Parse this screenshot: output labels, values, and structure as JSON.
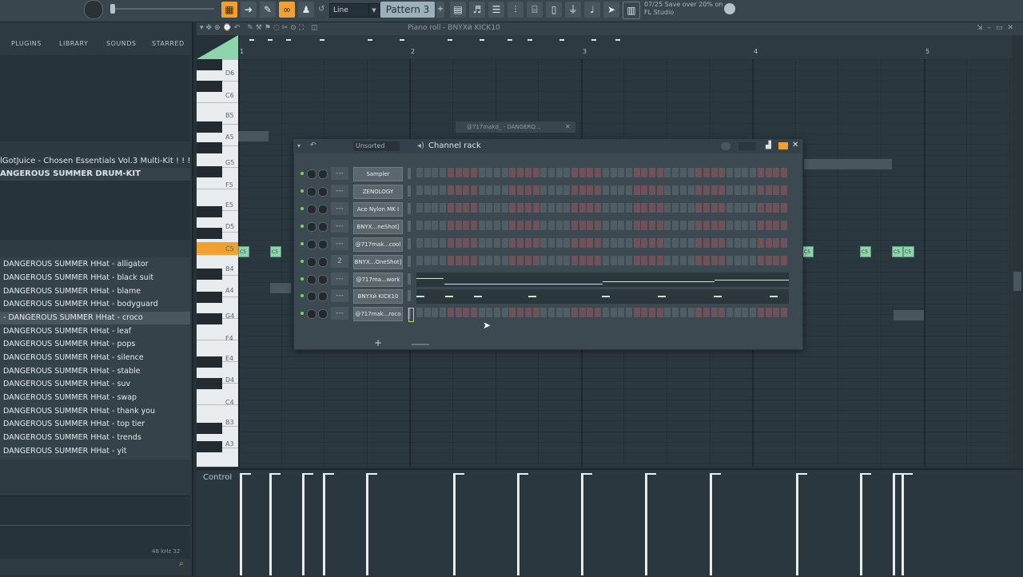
{
  "toolbar": {
    "snap_value": "Line",
    "pattern": "Pattern 3",
    "hint": "07/25  Save over 20% on FL Studio"
  },
  "browser": {
    "tabs": [
      "PLUGINS",
      "LIBRARY",
      "SOUNDS",
      "STARRED"
    ],
    "folders": [
      "lGotJuice - Chosen Essentials Vol.3 Multi-Kit ! ! ! !",
      "ANGEROUS SUMMER DRUM-KIT"
    ],
    "files": [
      "DANGEROUS SUMMER HHat - alligator",
      "DANGEROUS SUMMER HHat - black suit",
      "DANGEROUS SUMMER HHat - blame",
      "DANGEROUS SUMMER HHat - bodyguard",
      "- DANGEROUS SUMMER HHat - croco",
      "DANGEROUS SUMMER HHat - leaf",
      "DANGEROUS SUMMER HHat - pops",
      "DANGEROUS SUMMER HHat - silence",
      "DANGEROUS SUMMER HHat - stable",
      "DANGEROUS SUMMER HHat - suv",
      "DANGEROUS SUMMER HHat - swap",
      "DANGEROUS SUMMER HHat - thank you",
      "DANGEROUS SUMMER HHat - top tier",
      "DANGEROUS SUMMER HHat - trends",
      "DANGEROUS SUMMER HHat - yit"
    ],
    "selected_index": 4,
    "size_label": "48 kHz 32"
  },
  "piano_roll": {
    "title": "Piano roll - BNYXй  KICK10",
    "bars": [
      "1",
      "2",
      "3",
      "4",
      "5"
    ],
    "key_labels": [
      "D6",
      "C6",
      "B5",
      "A5",
      "G5",
      "F5",
      "E5",
      "D5",
      "C5",
      "B4",
      "A4",
      "G4",
      "F4",
      "E4",
      "D4",
      "C4",
      "B3",
      "A3"
    ],
    "note_label": "C5",
    "control_label": "Control"
  },
  "channel_rack": {
    "title": "Channel rack",
    "filter": "Unsorted",
    "ghost_title": "@717makd_ - DANGERO...",
    "channels": [
      {
        "name": "Sampler",
        "route": "---"
      },
      {
        "name": "ZENOLOGY",
        "route": "---"
      },
      {
        "name": "Ace Nylon MK I",
        "route": "---"
      },
      {
        "name": "BNYX...neShot]",
        "route": "---"
      },
      {
        "name": "@717mak...cool",
        "route": "---"
      },
      {
        "name": "BNYX...OneShot]",
        "route": "2"
      },
      {
        "name": "@717ma...work",
        "route": "---"
      },
      {
        "name": "BNYXй  KICK10",
        "route": "---"
      },
      {
        "name": "@717mak...roco",
        "route": "---"
      }
    ],
    "add_label": "+"
  },
  "colors": {
    "accent": "#f0a030",
    "note": "#8ed4ac",
    "background": "#2b373e"
  }
}
